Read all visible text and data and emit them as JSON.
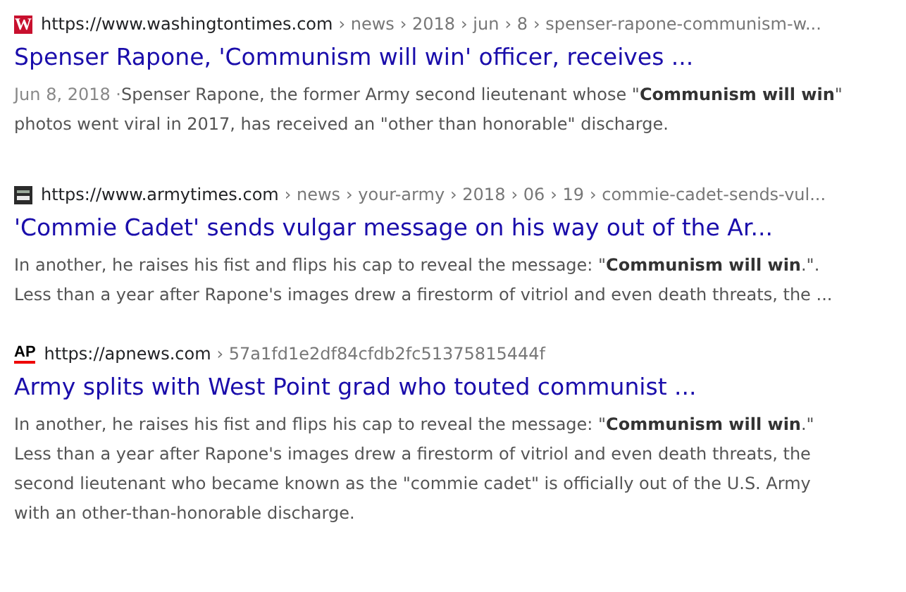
{
  "results": [
    {
      "favicon": {
        "kind": "washington",
        "text": "W"
      },
      "domain": "https://www.washingtontimes.com",
      "path": [
        "› news",
        "› 2018",
        "› jun",
        "› 8",
        "› spenser-rapone-communism-w..."
      ],
      "title": "Spenser Rapone, 'Communism will win' officer, receives ...",
      "date": "Jun 8, 2018 ·",
      "snippet": "Spenser Rapone, the former Army second lieutenant whose \"**Communism will win**\" photos went viral in 2017, has received an \"other than honorable\" discharge."
    },
    {
      "favicon": {
        "kind": "armytimes"
      },
      "domain": "https://www.armytimes.com",
      "path": [
        "› news",
        "› your-army",
        "› 2018",
        "› 06",
        "› 19",
        "› commie-cadet-sends-vul..."
      ],
      "title": "'Commie Cadet' sends vulgar message on his way out of the Ar...",
      "snippet": "In another, he raises his fist and flips his cap to reveal the message: \"**Communism will win**.\". Less than a year after Rapone's images drew a firestorm of vitriol and even death threats, the ..."
    },
    {
      "favicon": {
        "kind": "ap",
        "text": "AP"
      },
      "domain": "https://apnews.com",
      "path": [
        "› 57a1fd1e2df84cfdb2fc51375815444f"
      ],
      "title": "Army splits with West Point grad who touted communist ...",
      "snippet": "In another, he raises his fist and flips his cap to reveal the message: \"**Communism will win**.\" Less than a year after Rapone's images drew a firestorm of vitriol and even death threats, the second lieutenant who became known as the \"commie cadet\" is officially out of the U.S. Army with an other-than-honorable discharge."
    }
  ]
}
